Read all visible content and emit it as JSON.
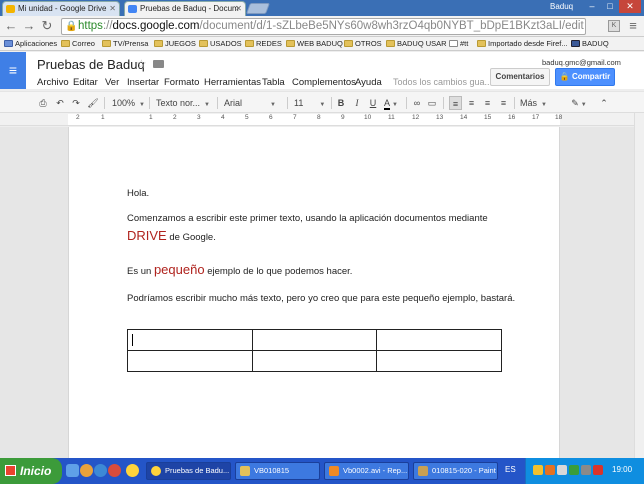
{
  "browser": {
    "tabs": [
      {
        "label": "Mi unidad - Google Drive"
      },
      {
        "label": "Pruebas de Baduq - Docum"
      }
    ],
    "window_user": "Baduq",
    "url_scheme": "https",
    "url_host": "docs.google.com",
    "url_path": "/document/d/1-sZLbeBe5NYs60w8wh3rzO4qb0NYBT_bDpE1BKzt3aLI/edit",
    "bookmarks": [
      "Aplicaciones",
      "Correo",
      "TV/Prensa",
      "JUEGOS",
      "USADOS",
      "REDES",
      "WEB BADUQ",
      "OTROS",
      "BADUQ USAR",
      "#tt",
      "Importado desde Firef...",
      "BADUQ"
    ]
  },
  "docs": {
    "title": "Pruebas de Baduq",
    "menu": [
      "Archivo",
      "Editar",
      "Ver",
      "Insertar",
      "Formato",
      "Herramientas",
      "Tabla",
      "Complementos",
      "Ayuda"
    ],
    "saved_status": "Todos los cambios gua...",
    "user_email": "baduq.gmc@gmail.com",
    "comments_label": "Comentarios",
    "share_label": "Compartir",
    "toolbar": {
      "zoom": "100%",
      "style": "Texto nor...",
      "font": "Arial",
      "size": "11",
      "more": "Más"
    },
    "ruler_numbers": [
      "2",
      "1",
      "1",
      "2",
      "3",
      "4",
      "5",
      "6",
      "7",
      "8",
      "9",
      "10",
      "11",
      "12",
      "13",
      "14",
      "15",
      "16",
      "17",
      "18"
    ]
  },
  "document": {
    "line1": "Hola.",
    "line2": "Comenzamos a escribir este primer texto, usando la aplicación documentos mediante",
    "line3_red": "DRIVE",
    "line3_rest": " de Google.",
    "line4_pre": "Es un ",
    "line4_red": "pequeño",
    "line4_post": " ejemplo de lo que podemos hacer.",
    "line5": "Podríamos escribir mucho más texto, pero yo creo que para este pequeño ejemplo, bastará.",
    "accent_red": "#b0231e"
  },
  "taskbar": {
    "start": "Inicio",
    "tasks": [
      "Pruebas de Badu...",
      "VB010815",
      "Vb0002.avi - Rep...",
      "010815-020 - Paint"
    ],
    "lang": "ES",
    "clock": "19:00"
  }
}
